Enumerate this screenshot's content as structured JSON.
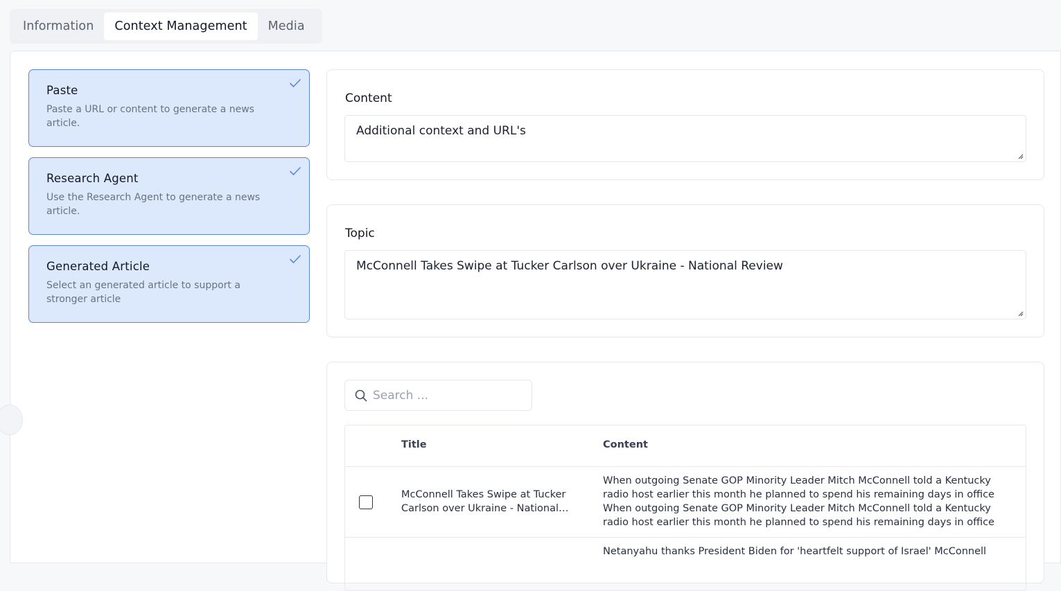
{
  "tabs": [
    {
      "label": "Information"
    },
    {
      "label": "Context Management"
    },
    {
      "label": "Media"
    }
  ],
  "options": [
    {
      "title": "Paste",
      "description": "Paste a URL or content to generate a news article."
    },
    {
      "title": "Research Agent",
      "description": "Use the Research Agent to generate a news article."
    },
    {
      "title": "Generated Article",
      "description": "Select an generated article to support a stronger article"
    }
  ],
  "content": {
    "label": "Content",
    "value": "Additional context and URL's"
  },
  "topic": {
    "label": "Topic",
    "value": "McConnell Takes Swipe at Tucker Carlson over Ukraine - National Review"
  },
  "search": {
    "placeholder": "Search ..."
  },
  "table": {
    "columns": {
      "title": "Title",
      "content": "Content"
    },
    "rows": [
      {
        "title": "McConnell Takes Swipe at Tucker Carlson over Ukraine - National Review",
        "content_a": "When outgoing Senate GOP Minority Leader Mitch McConnell told a Kentucky radio host earlier this month he planned to spend his remaining days in office",
        "content_b": "When outgoing Senate GOP Minority Leader Mitch McConnell told a Kentucky radio host earlier this month he planned to spend his remaining days in office"
      },
      {
        "title": "",
        "content_a": "Netanyahu thanks President Biden for 'heartfelt support of Israel' McConnell",
        "content_b": ""
      }
    ]
  },
  "colors": {
    "accent": "#5b86e0",
    "option_bg": "#dce9fd"
  }
}
